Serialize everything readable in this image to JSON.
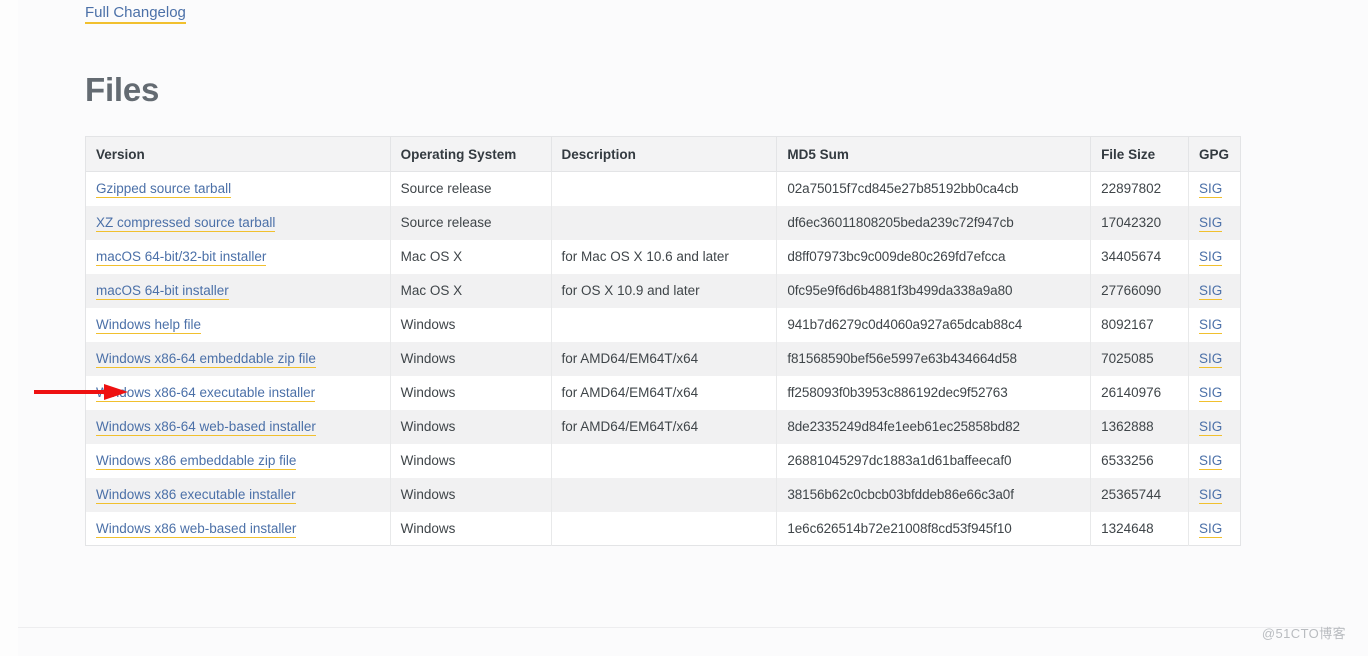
{
  "page": {
    "changelog_link": "Full Changelog",
    "section_title": "Files",
    "watermark": "@51CTO博客"
  },
  "colors": {
    "link": "#4b70a8",
    "link_underline": "#f1c02e",
    "heading": "#646b72",
    "header_bg": "#f3f3f4",
    "row_alt_bg": "#f1f1f2",
    "page_bg": "#fbfbfc",
    "arrow": "#ee1111"
  },
  "table": {
    "columns": [
      "Version",
      "Operating System",
      "Description",
      "MD5 Sum",
      "File Size",
      "GPG"
    ],
    "gpg_label": "SIG",
    "rows": [
      {
        "version": "Gzipped source tarball",
        "os": "Source release",
        "description": "",
        "md5": "02a75015f7cd845e27b85192bb0ca4cb",
        "size": "22897802",
        "gpg": "SIG"
      },
      {
        "version": "XZ compressed source tarball",
        "os": "Source release",
        "description": "",
        "md5": "df6ec36011808205beda239c72f947cb",
        "size": "17042320",
        "gpg": "SIG"
      },
      {
        "version": "macOS 64-bit/32-bit installer",
        "os": "Mac OS X",
        "description": "for Mac OS X 10.6 and later",
        "md5": "d8ff07973bc9c009de80c269fd7efcca",
        "size": "34405674",
        "gpg": "SIG"
      },
      {
        "version": "macOS 64-bit installer",
        "os": "Mac OS X",
        "description": "for OS X 10.9 and later",
        "md5": "0fc95e9f6d6b4881f3b499da338a9a80",
        "size": "27766090",
        "gpg": "SIG"
      },
      {
        "version": "Windows help file",
        "os": "Windows",
        "description": "",
        "md5": "941b7d6279c0d4060a927a65dcab88c4",
        "size": "8092167",
        "gpg": "SIG"
      },
      {
        "version": "Windows x86-64 embeddable zip file",
        "os": "Windows",
        "description": "for AMD64/EM64T/x64",
        "md5": "f81568590bef56e5997e63b434664d58",
        "size": "7025085",
        "gpg": "SIG"
      },
      {
        "version": "Windows x86-64 executable installer",
        "os": "Windows",
        "description": "for AMD64/EM64T/x64",
        "md5": "ff258093f0b3953c886192dec9f52763",
        "size": "26140976",
        "gpg": "SIG"
      },
      {
        "version": "Windows x86-64 web-based installer",
        "os": "Windows",
        "description": "for AMD64/EM64T/x64",
        "md5": "8de2335249d84fe1eeb61ec25858bd82",
        "size": "1362888",
        "gpg": "SIG"
      },
      {
        "version": "Windows x86 embeddable zip file",
        "os": "Windows",
        "description": "",
        "md5": "26881045297dc1883a1d61baffeecaf0",
        "size": "6533256",
        "gpg": "SIG"
      },
      {
        "version": "Windows x86 executable installer",
        "os": "Windows",
        "description": "",
        "md5": "38156b62c0cbcb03bfddeb86e66c3a0f",
        "size": "25365744",
        "gpg": "SIG"
      },
      {
        "version": "Windows x86 web-based installer",
        "os": "Windows",
        "description": "",
        "md5": "1e6c626514b72e21008f8cd53f945f10",
        "size": "1324648",
        "gpg": "SIG"
      }
    ]
  },
  "annotation": {
    "arrow_target_row": "Windows x86-64 executable installer"
  }
}
